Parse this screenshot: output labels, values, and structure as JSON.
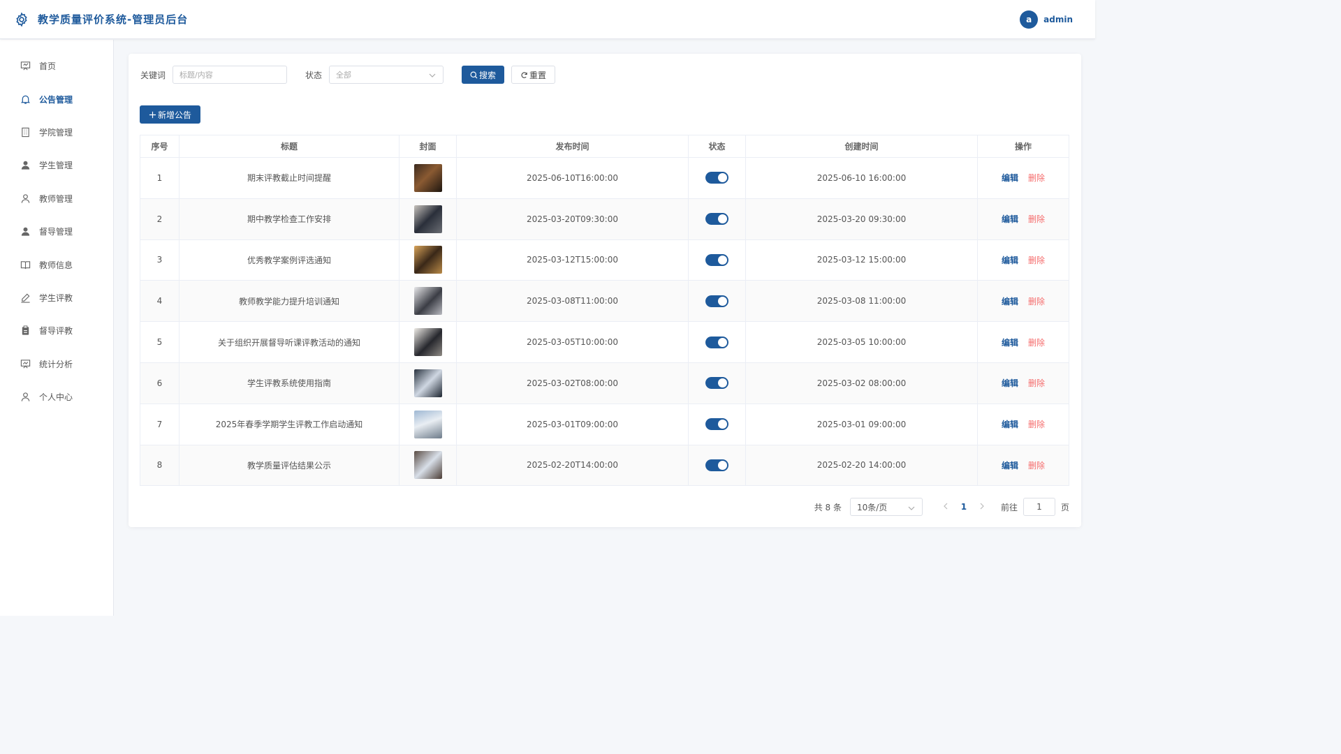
{
  "header": {
    "title": "教学质量评价系统-管理员后台",
    "avatar_letter": "a",
    "username": "admin"
  },
  "sidebar": {
    "items": [
      {
        "label": "首页",
        "icon": "dashboard-icon"
      },
      {
        "label": "公告管理",
        "icon": "bell-icon",
        "active": true
      },
      {
        "label": "学院管理",
        "icon": "building-icon"
      },
      {
        "label": "学生管理",
        "icon": "user-filled-icon"
      },
      {
        "label": "教师管理",
        "icon": "user-icon"
      },
      {
        "label": "督导管理",
        "icon": "user-filled-icon"
      },
      {
        "label": "教师信息",
        "icon": "book-icon"
      },
      {
        "label": "学生评教",
        "icon": "pen-icon"
      },
      {
        "label": "督导评教",
        "icon": "clipboard-icon"
      },
      {
        "label": "统计分析",
        "icon": "chart-board-icon"
      },
      {
        "label": "个人中心",
        "icon": "user-icon"
      }
    ]
  },
  "filter": {
    "keyword_label": "关键词",
    "keyword_placeholder": "标题/内容",
    "status_label": "状态",
    "status_value": "全部",
    "search_label": "搜索",
    "reset_label": "重置"
  },
  "add_button": "新增公告",
  "table": {
    "headers": [
      "序号",
      "标题",
      "封面",
      "发布时间",
      "状态",
      "创建时间",
      "操作"
    ],
    "edit_label": "编辑",
    "delete_label": "删除",
    "rows": [
      {
        "no": "1",
        "title": "期末评教截止时间提醒",
        "publish": "2025-06-10T16:00:00",
        "enabled": true,
        "created": "2025-06-10 16:00:00"
      },
      {
        "no": "2",
        "title": "期中教学检查工作安排",
        "publish": "2025-03-20T09:30:00",
        "enabled": true,
        "created": "2025-03-20 09:30:00"
      },
      {
        "no": "3",
        "title": "优秀教学案例评选通知",
        "publish": "2025-03-12T15:00:00",
        "enabled": true,
        "created": "2025-03-12 15:00:00"
      },
      {
        "no": "4",
        "title": "教师教学能力提升培训通知",
        "publish": "2025-03-08T11:00:00",
        "enabled": true,
        "created": "2025-03-08 11:00:00"
      },
      {
        "no": "5",
        "title": "关于组织开展督导听课评教活动的通知",
        "publish": "2025-03-05T10:00:00",
        "enabled": true,
        "created": "2025-03-05 10:00:00"
      },
      {
        "no": "6",
        "title": "学生评教系统使用指南",
        "publish": "2025-03-02T08:00:00",
        "enabled": true,
        "created": "2025-03-02 08:00:00"
      },
      {
        "no": "7",
        "title": "2025年春季学期学生评教工作启动通知",
        "publish": "2025-03-01T09:00:00",
        "enabled": true,
        "created": "2025-03-01 09:00:00"
      },
      {
        "no": "8",
        "title": "教学质量评估结果公示",
        "publish": "2025-02-20T14:00:00",
        "enabled": true,
        "created": "2025-02-20 14:00:00"
      }
    ]
  },
  "pagination": {
    "total_text": "共 8 条",
    "page_size": "10条/页",
    "current_page": "1",
    "goto_label": "前往",
    "goto_value": "1",
    "page_suffix": "页"
  },
  "colors": {
    "primary": "#1e5a9c",
    "danger": "#f56c6c"
  }
}
